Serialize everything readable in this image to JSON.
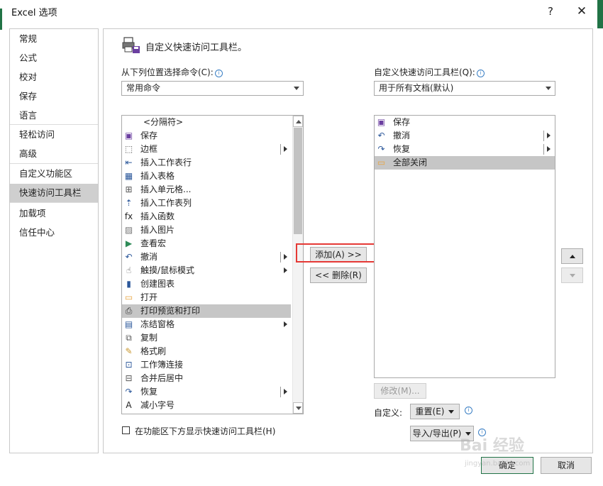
{
  "window": {
    "title": "Excel 选项",
    "help_label": "?",
    "close_label": "✕"
  },
  "sidebar": {
    "items": [
      {
        "label": "常规"
      },
      {
        "label": "公式"
      },
      {
        "label": "校对"
      },
      {
        "label": "保存"
      },
      {
        "label": "语言"
      },
      {
        "label": "轻松访问"
      },
      {
        "label": "高级"
      },
      {
        "label": "自定义功能区"
      },
      {
        "label": "快速访问工具栏",
        "active": true
      },
      {
        "label": "加载项"
      },
      {
        "label": "信任中心"
      }
    ]
  },
  "main": {
    "heading": "自定义快速访问工具栏。",
    "choose_label": "从下列位置选择命令(C):",
    "choose_value": "常用命令",
    "qat_label": "自定义快速访问工具栏(Q):",
    "qat_value": "用于所有文档(默认)",
    "commands": [
      {
        "label": "<分隔符>",
        "icon": "separator-icon",
        "glyph": ""
      },
      {
        "label": "保存",
        "icon": "save-icon",
        "glyph": "▣",
        "color": "#6b3fa0"
      },
      {
        "label": "边框",
        "icon": "borders-icon",
        "glyph": "⬚",
        "color": "#555555",
        "submenu_bar": true
      },
      {
        "label": "插入工作表行",
        "icon": "insert-row-icon",
        "glyph": "⇤",
        "color": "#2b579a"
      },
      {
        "label": "插入表格",
        "icon": "insert-table-icon",
        "glyph": "▦",
        "color": "#2b579a"
      },
      {
        "label": "插入单元格...",
        "icon": "insert-cells-icon",
        "glyph": "⊞",
        "color": "#555555"
      },
      {
        "label": "插入工作表列",
        "icon": "insert-column-icon",
        "glyph": "⇡",
        "color": "#2b579a"
      },
      {
        "label": "插入函数",
        "icon": "function-icon",
        "glyph": "fx",
        "color": "#222222"
      },
      {
        "label": "插入图片",
        "icon": "picture-icon",
        "glyph": "▨",
        "color": "#777777"
      },
      {
        "label": "查看宏",
        "icon": "macro-icon",
        "glyph": "▶",
        "color": "#2e8b57"
      },
      {
        "label": "撤消",
        "icon": "undo-icon",
        "glyph": "↶",
        "color": "#2b579a",
        "submenu_bar": true
      },
      {
        "label": "触摸/鼠标模式",
        "icon": "touch-mode-icon",
        "glyph": "☝",
        "color": "#555555",
        "submenu": true
      },
      {
        "label": "创建图表",
        "icon": "chart-icon",
        "glyph": "▮",
        "color": "#2b579a"
      },
      {
        "label": "打开",
        "icon": "open-folder-icon",
        "glyph": "▭",
        "color": "#e8a33d"
      },
      {
        "label": "打印预览和打印",
        "icon": "print-preview-icon",
        "glyph": "⎙",
        "color": "#333333",
        "selected": true
      },
      {
        "label": "冻结窗格",
        "icon": "freeze-panes-icon",
        "glyph": "▤",
        "color": "#2b579a",
        "submenu": true
      },
      {
        "label": "复制",
        "icon": "copy-icon",
        "glyph": "⧉",
        "color": "#555555"
      },
      {
        "label": "格式刷",
        "icon": "format-painter-icon",
        "glyph": "✎",
        "color": "#c8952c"
      },
      {
        "label": "工作簿连接",
        "icon": "connections-icon",
        "glyph": "⊡",
        "color": "#2b579a"
      },
      {
        "label": "合并后居中",
        "icon": "merge-center-icon",
        "glyph": "⊟",
        "color": "#555555"
      },
      {
        "label": "恢复",
        "icon": "redo-icon",
        "glyph": "↷",
        "color": "#2b579a",
        "submenu_bar": true
      },
      {
        "label": "减小字号",
        "icon": "decrease-font-icon",
        "glyph": "A",
        "color": "#222222"
      },
      {
        "label": "",
        "icon": "partial-icon",
        "glyph": "⌄",
        "color": "#555555"
      }
    ],
    "add_button": "添加(A) >>",
    "remove_button": "<< 删除(R)",
    "qat_items": [
      {
        "label": "保存",
        "icon": "save-icon",
        "glyph": "▣",
        "color": "#6b3fa0"
      },
      {
        "label": "撤消",
        "icon": "undo-icon",
        "glyph": "↶",
        "color": "#2b579a",
        "submenu_bar": true
      },
      {
        "label": "恢复",
        "icon": "redo-icon",
        "glyph": "↷",
        "color": "#2b579a",
        "submenu_bar": true
      },
      {
        "label": "全部关闭",
        "icon": "folder-icon",
        "glyph": "▭",
        "color": "#e8a33d",
        "selected": true
      }
    ],
    "modify_button": "修改(M)...",
    "customize_label": "自定义:",
    "reset_button": "重置(E)",
    "import_export_button": "导入/导出(P)",
    "show_below_ribbon": "在功能区下方显示快速访问工具栏(H)"
  },
  "footer": {
    "ok": "确定",
    "cancel": "取消"
  },
  "watermark": {
    "text": "Bai 经验",
    "sub": "jingyan.baidu.com"
  }
}
